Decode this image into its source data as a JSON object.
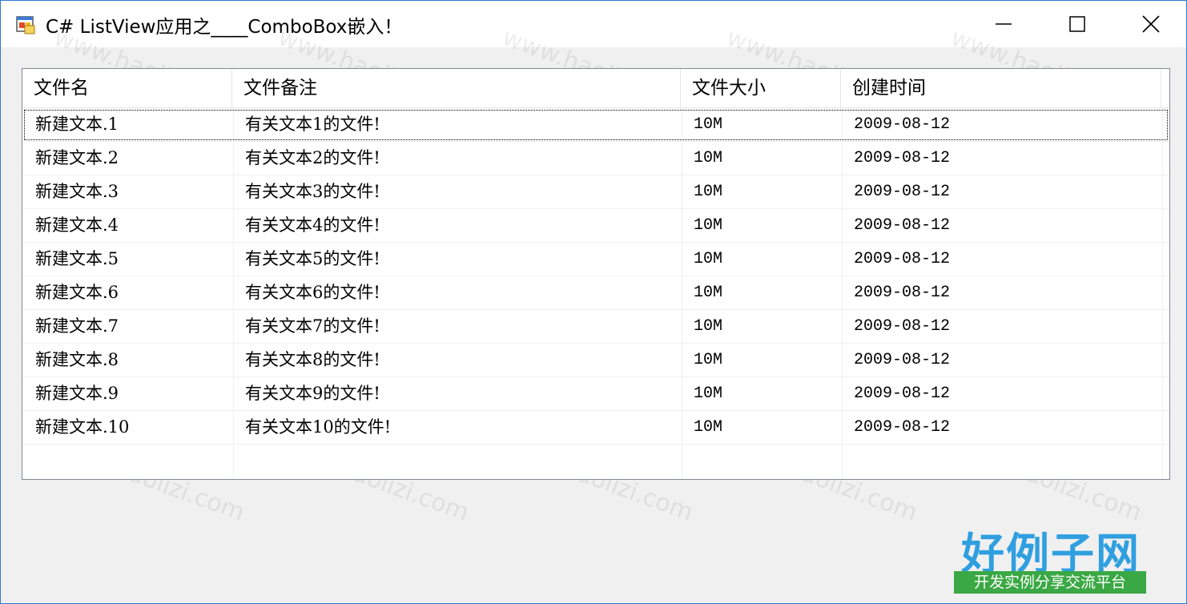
{
  "window": {
    "title": "C# ListView应用之____ComboBox嵌入！",
    "minimize_icon": "minimize-icon",
    "maximize_icon": "maximize-icon",
    "close_icon": "close-icon"
  },
  "listview": {
    "columns": [
      "文件名",
      "文件备注",
      "文件大小",
      "创建时间"
    ],
    "rows": [
      [
        "新建文本.1",
        "有关文本1的文件!",
        "10M",
        "2009-08-12"
      ],
      [
        "新建文本.2",
        "有关文本2的文件!",
        "10M",
        "2009-08-12"
      ],
      [
        "新建文本.3",
        "有关文本3的文件!",
        "10M",
        "2009-08-12"
      ],
      [
        "新建文本.4",
        "有关文本4的文件!",
        "10M",
        "2009-08-12"
      ],
      [
        "新建文本.5",
        "有关文本5的文件!",
        "10M",
        "2009-08-12"
      ],
      [
        "新建文本.6",
        "有关文本6的文件!",
        "10M",
        "2009-08-12"
      ],
      [
        "新建文本.7",
        "有关文本7的文件!",
        "10M",
        "2009-08-12"
      ],
      [
        "新建文本.8",
        "有关文本8的文件!",
        "10M",
        "2009-08-12"
      ],
      [
        "新建文本.9",
        "有关文本9的文件!",
        "10M",
        "2009-08-12"
      ],
      [
        "新建文本.10",
        "有关文本10的文件!",
        "10M",
        "2009-08-12"
      ]
    ],
    "selected_row": 0
  },
  "watermark": {
    "text": "www.haolizi.com"
  },
  "logo": {
    "main": "好例子网",
    "sub": "开发实例分享交流平台"
  },
  "colors": {
    "window_border": "#2b78d4",
    "logo_blue": "#2f9fe0",
    "logo_green": "#3aa844"
  }
}
